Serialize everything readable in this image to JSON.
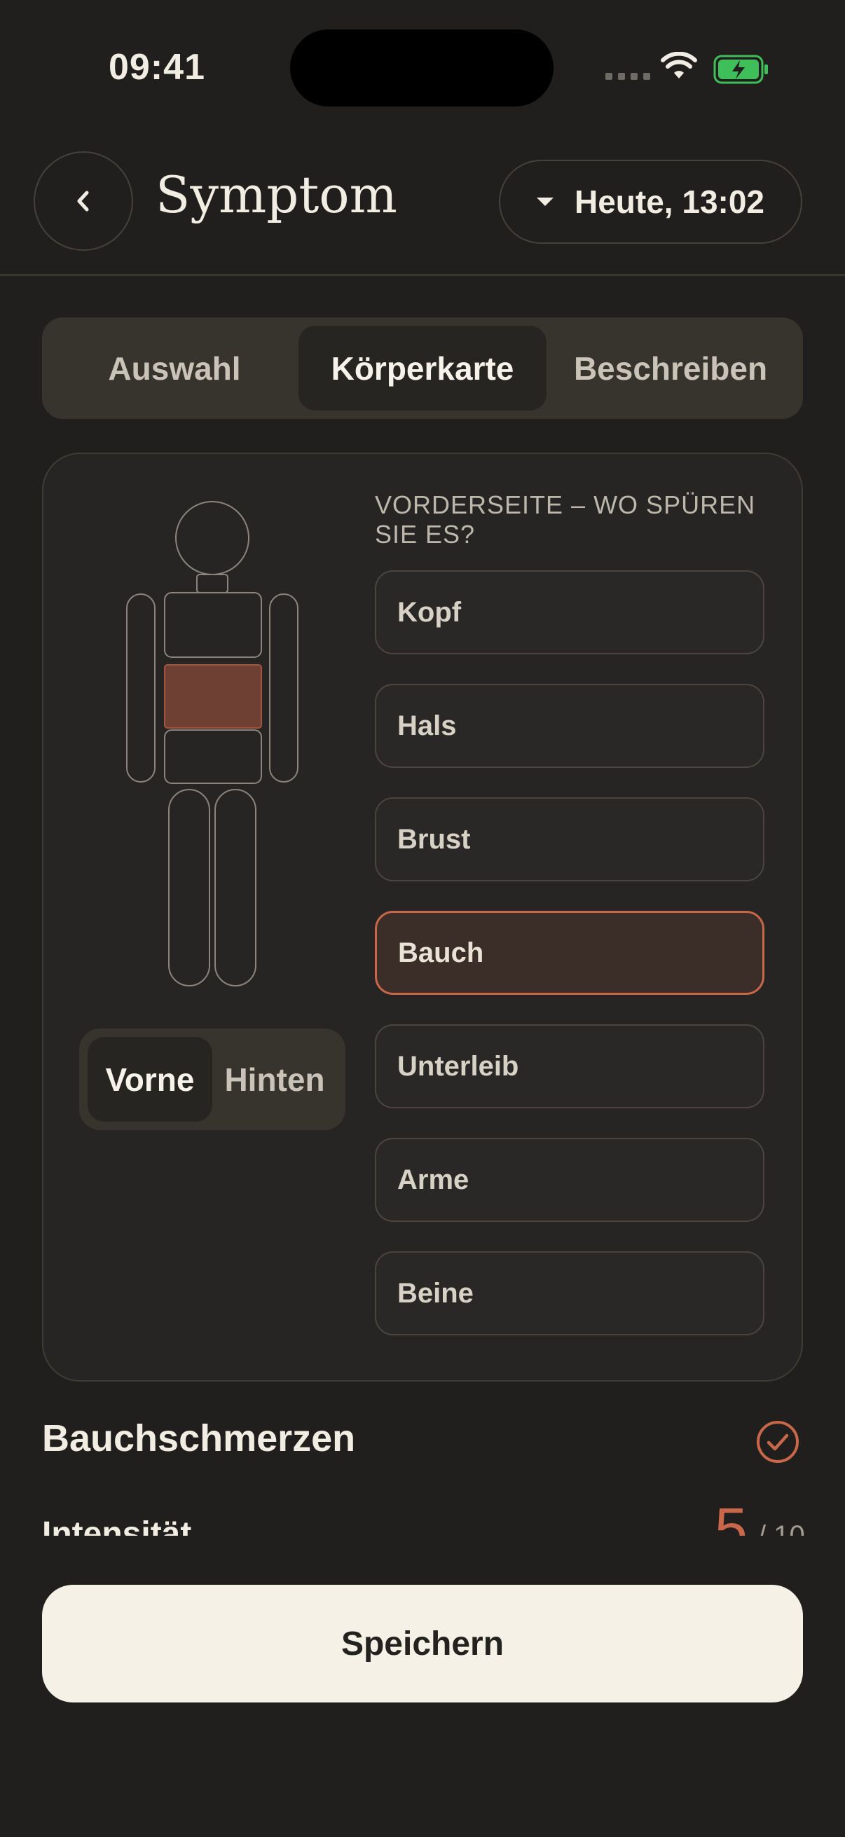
{
  "status_bar": {
    "time": "09:41"
  },
  "header": {
    "title": "Symptom",
    "date": "Heute, 13:02"
  },
  "tabs": [
    {
      "label": "Auswahl",
      "active": false
    },
    {
      "label": "Körperkarte",
      "active": true
    },
    {
      "label": "Beschreiben",
      "active": false
    }
  ],
  "body_map": {
    "heading": "VORDERSEITE – WO SPÜREN SIE ES?",
    "regions": [
      {
        "label": "Kopf",
        "selected": false
      },
      {
        "label": "Hals",
        "selected": false
      },
      {
        "label": "Brust",
        "selected": false
      },
      {
        "label": "Bauch",
        "selected": true
      },
      {
        "label": "Unterleib",
        "selected": false
      },
      {
        "label": "Arme",
        "selected": false
      },
      {
        "label": "Beine",
        "selected": false
      }
    ],
    "side_toggle": {
      "front": "Vorne",
      "back": "Hinten",
      "active": "front"
    }
  },
  "symptom": {
    "name": "Bauchschmerzen"
  },
  "intensity": {
    "label": "Intensität",
    "value": "5",
    "max": "/ 10"
  },
  "save_label": "Speichern",
  "colors": {
    "accent": "#c8674a",
    "background": "#211f1d",
    "selected_region_fill": "#6e3f33"
  }
}
